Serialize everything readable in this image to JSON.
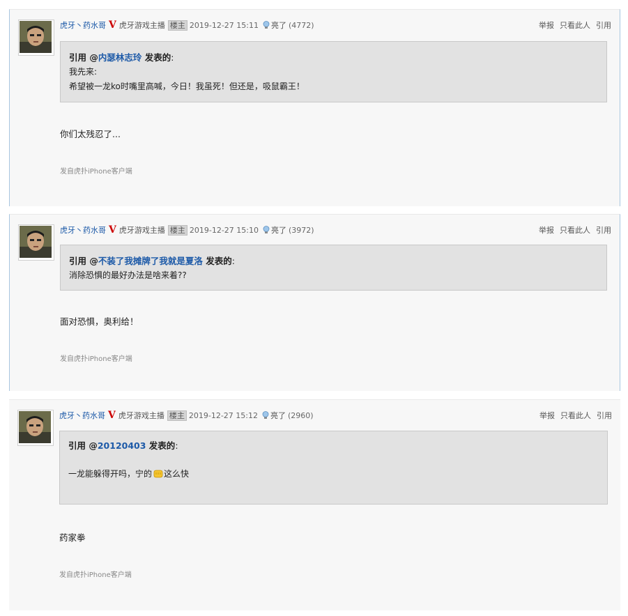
{
  "posts": [
    {
      "user": "虎牙丶药水哥",
      "v_badge": "V",
      "role": "虎牙游戏主播",
      "tag": "楼主",
      "time": "2019-12-27 15:11",
      "light_label": "亮了",
      "light_count": "(4772)",
      "actions": [
        "举报",
        "只看此人",
        "引用"
      ],
      "quote": {
        "prefix": "引用 @",
        "user": "内瑟林志玲",
        "suffix": " 发表的",
        "colon": ":",
        "lines": [
          "我先来:",
          "希望被一龙ko时嘴里高喊，今日！我虽死！但还是，吸鼠霸王！"
        ]
      },
      "body": "你们太残忍了...",
      "source": "发自虎扑iPhone客户端"
    },
    {
      "user": "虎牙丶药水哥",
      "v_badge": "V",
      "role": "虎牙游戏主播",
      "tag": "楼主",
      "time": "2019-12-27 15:10",
      "light_label": "亮了",
      "light_count": "(3972)",
      "actions": [
        "举报",
        "只看此人",
        "引用"
      ],
      "quote": {
        "prefix": "引用 @",
        "user": "不装了我摊牌了我就是夏洛",
        "suffix": " 发表的",
        "colon": ":",
        "lines": [
          "消除恐惧的最好办法是啥来着??"
        ]
      },
      "body": "面对恐惧，奥利给！",
      "source": "发自虎扑iPhone客户端"
    },
    {
      "user": "虎牙丶药水哥",
      "v_badge": "V",
      "role": "虎牙游戏主播",
      "tag": "楼主",
      "time": "2019-12-27 15:12",
      "light_label": "亮了",
      "light_count": "(2960)",
      "actions": [
        "举报",
        "只看此人",
        "引用"
      ],
      "quote": {
        "prefix": "引用 @",
        "user": "20120403",
        "suffix": " 发表的",
        "colon": ":",
        "line_a": "一龙能躲得开吗，宁的",
        "line_b": "这么快"
      },
      "body": "药家拳",
      "source": "发自虎扑iPhone客户端"
    }
  ]
}
